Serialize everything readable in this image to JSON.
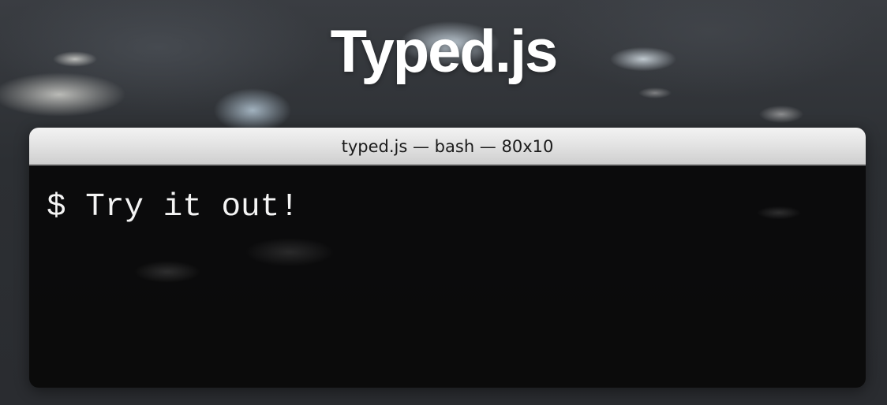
{
  "page": {
    "title": "Typed.js"
  },
  "terminal": {
    "window_title": "typed.js — bash — 80x10",
    "prompt_symbol": "$",
    "typed_text": "Try it out!"
  },
  "colors": {
    "title_text": "#ffffff",
    "terminal_background": "#080808",
    "terminal_text": "#f4f4f4",
    "title_bar": "#e4e4e4"
  }
}
